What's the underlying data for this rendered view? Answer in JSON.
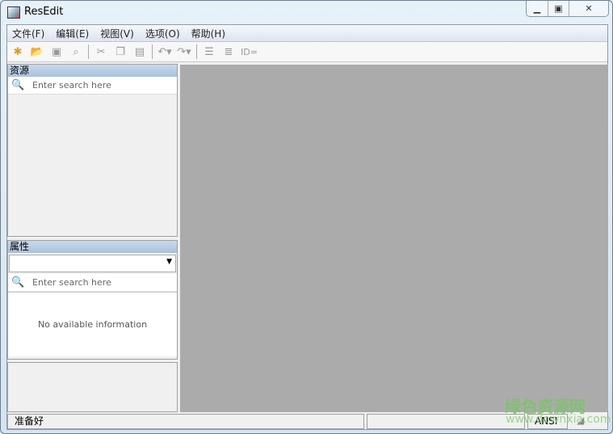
{
  "window": {
    "title": "ResEdit",
    "minimize_icon": "minimize-icon",
    "maximize_icon": "maximize-icon",
    "close_icon": "close-icon"
  },
  "menu": [
    "文件(F)",
    "编辑(E)",
    "视图(V)",
    "选项(O)",
    "帮助(H)"
  ],
  "toolbar": {
    "id_label": "ID="
  },
  "resources": {
    "title": "资源",
    "search_placeholder": "Enter search here"
  },
  "properties": {
    "title": "属性",
    "search_placeholder": "Enter search here",
    "empty": "No available information"
  },
  "status": {
    "text": "准备好",
    "encoding": "ANSI"
  },
  "watermark": {
    "name": "绿色资源网",
    "url": "www.downxia.com"
  }
}
